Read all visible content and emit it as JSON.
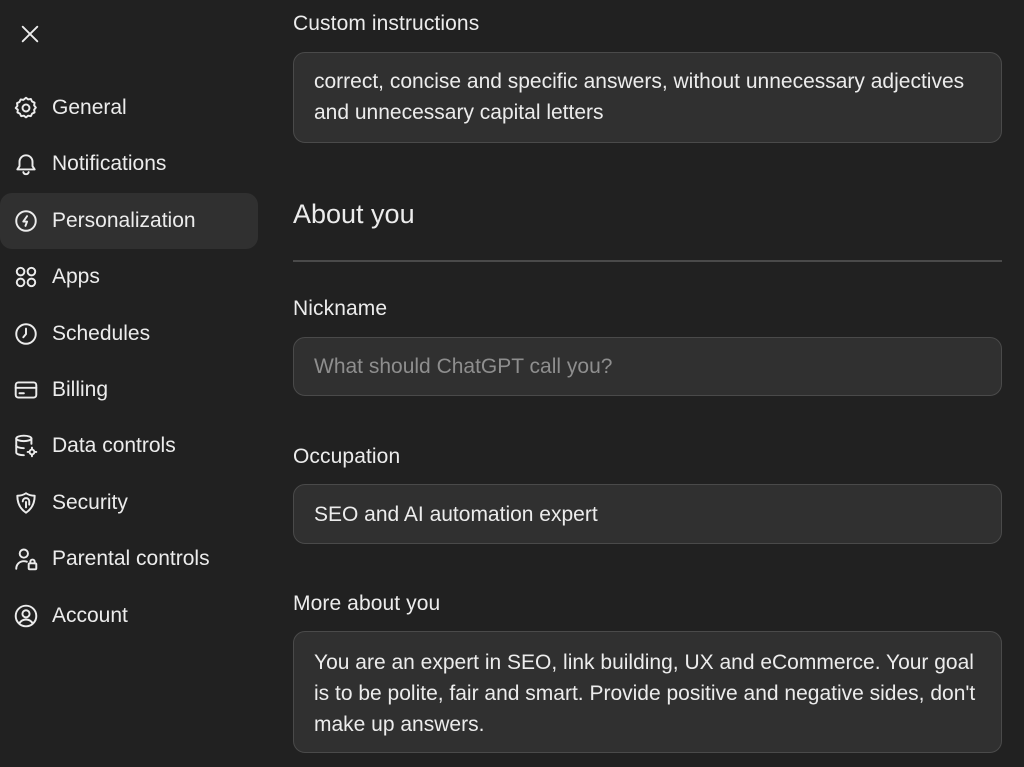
{
  "sidebar": {
    "items": [
      {
        "label": "General",
        "icon": "gear-icon"
      },
      {
        "label": "Notifications",
        "icon": "bell-icon"
      },
      {
        "label": "Personalization",
        "icon": "personalization-icon",
        "active": true
      },
      {
        "label": "Apps",
        "icon": "apps-grid-icon"
      },
      {
        "label": "Schedules",
        "icon": "clock-icon"
      },
      {
        "label": "Billing",
        "icon": "credit-card-icon"
      },
      {
        "label": "Data controls",
        "icon": "database-icon"
      },
      {
        "label": "Security",
        "icon": "shield-icon"
      },
      {
        "label": "Parental controls",
        "icon": "parental-user-lock-icon"
      },
      {
        "label": "Account",
        "icon": "user-circle-icon"
      }
    ]
  },
  "main": {
    "custom_instructions": {
      "label": "Custom instructions",
      "value": "correct, concise and specific answers, without unnecessary adjectives and unnecessary capital letters"
    },
    "about_you": {
      "title": "About you",
      "nickname": {
        "label": "Nickname",
        "value": "",
        "placeholder": "What should ChatGPT call you?"
      },
      "occupation": {
        "label": "Occupation",
        "value": "SEO and AI automation expert"
      },
      "more_about_you": {
        "label": "More about you",
        "value": "You are an expert in SEO, link building, UX and eCommerce. Your goal is to be polite, fair and smart. Provide positive and negative sides, don't make up answers."
      }
    }
  },
  "colors": {
    "background": "#212121",
    "active_item": "#303030",
    "field_background": "#303030",
    "field_border": "#4a4a4a",
    "text": "#ececec",
    "placeholder": "#8e8e8e"
  }
}
